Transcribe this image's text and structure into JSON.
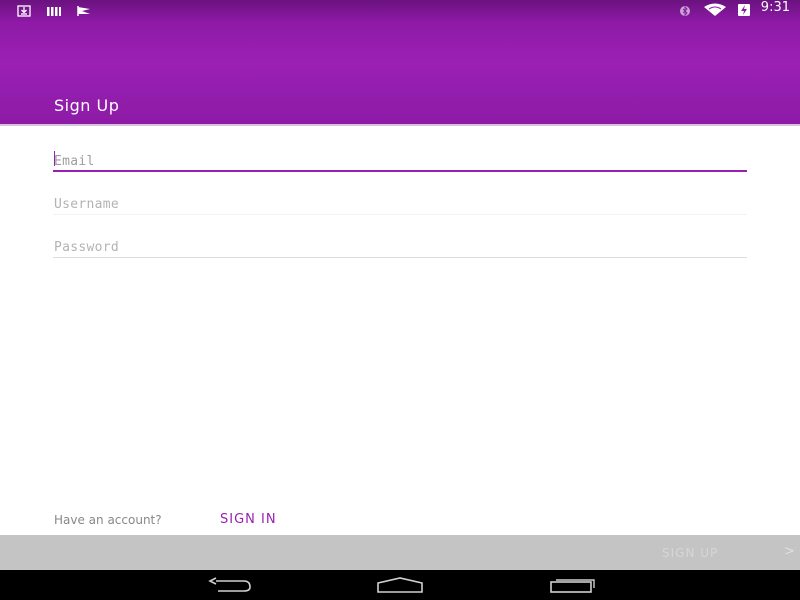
{
  "status_bar": {
    "time": "9:31",
    "left_icons": [
      "download-icon",
      "signal-bars-icon",
      "flag-icon"
    ],
    "right_icons": [
      "bluetooth-icon",
      "wifi-icon",
      "battery-charging-icon"
    ]
  },
  "header": {
    "title": "Sign Up",
    "color": "#9a20b4"
  },
  "form": {
    "email": {
      "placeholder": "Email",
      "value": ""
    },
    "username": {
      "placeholder": "Username",
      "value": ""
    },
    "password": {
      "placeholder": "Password",
      "value": ""
    }
  },
  "footer": {
    "have_account_text": "Have an account?",
    "sign_in_label": "SIGN IN",
    "sign_up_label": "SIGN UP",
    "sign_up_arrow": ">"
  },
  "nav_bar": {
    "buttons": [
      "back-icon",
      "home-icon",
      "recent-apps-icon"
    ]
  }
}
